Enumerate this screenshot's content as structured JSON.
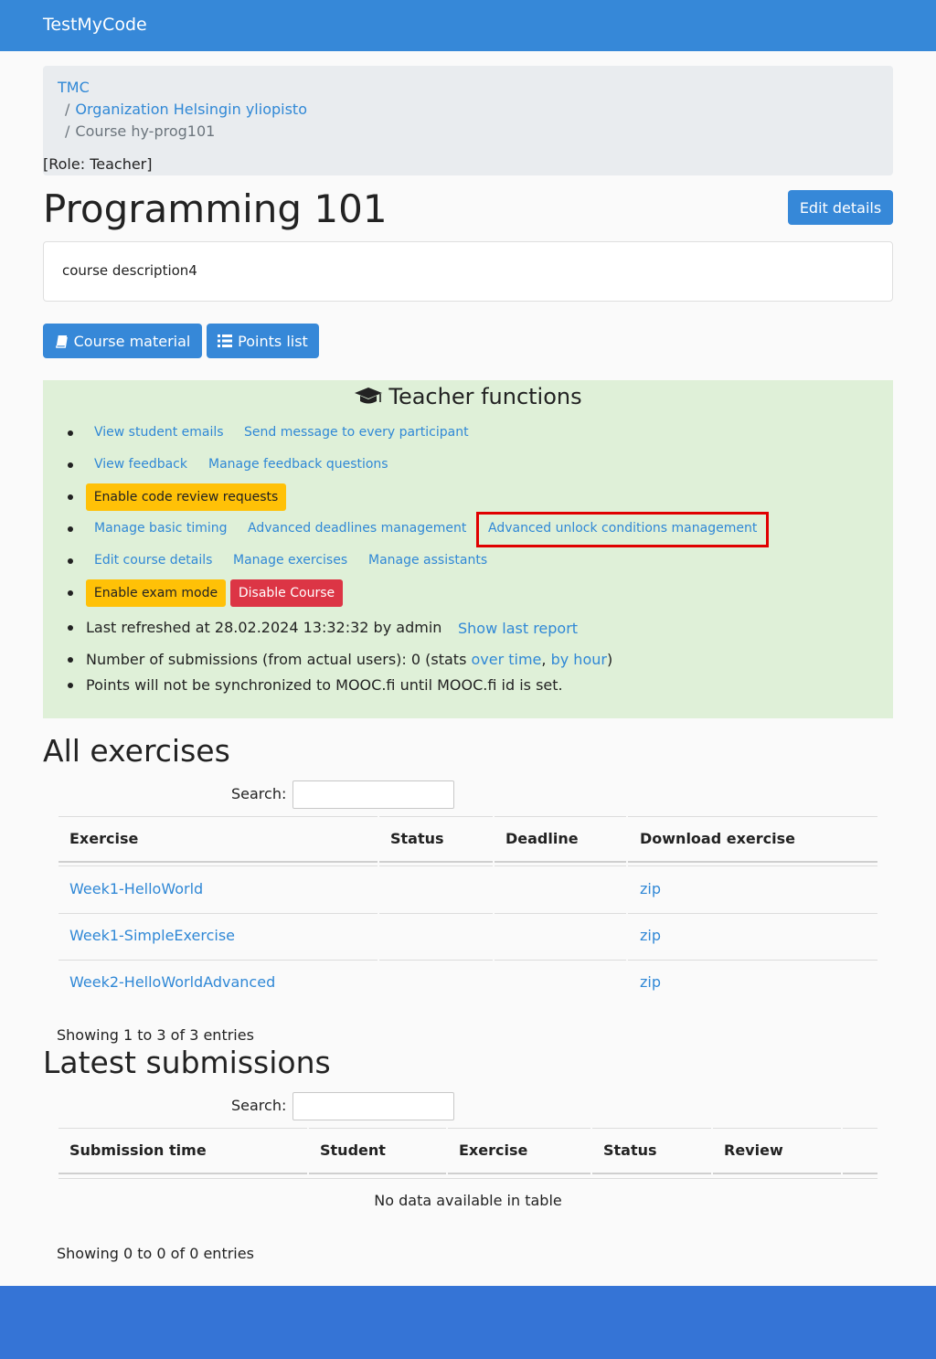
{
  "navbar": {
    "brand": "TestMyCode"
  },
  "breadcrumb": {
    "items": [
      "TMC",
      "Organization Helsingin yliopisto",
      "Course hy-prog101"
    ],
    "separator": "/",
    "role": "[Role: Teacher]"
  },
  "course": {
    "title": "Programming 101",
    "edit_label": "Edit details",
    "description": "course description4",
    "material_label": "Course material",
    "points_label": "Points list"
  },
  "teacher": {
    "title": "Teacher functions",
    "view_student_emails": "View student emails",
    "send_message": "Send message to every participant",
    "view_feedback": "View feedback",
    "manage_feedback_questions": "Manage feedback questions",
    "enable_code_review": "Enable code review requests",
    "manage_basic_timing": "Manage basic timing",
    "advanced_deadlines": "Advanced deadlines management",
    "advanced_unlock": "Advanced unlock conditions management",
    "edit_course_details": "Edit course details",
    "manage_exercises": "Manage exercises",
    "manage_assistants": "Manage assistants",
    "enable_exam_mode": "Enable exam mode",
    "disable_course": "Disable Course",
    "last_refreshed": "Last refreshed at 28.02.2024 13:32:32 by admin",
    "show_last_report": "Show last report",
    "submissions_prefix": "Number of submissions (from actual users): 0 (stats ",
    "over_time": "over time",
    "comma": ",",
    "by_hour": "by hour",
    "close_paren": ")",
    "mooc_note": "Points will not be synchronized to MOOC.fi until MOOC.fi id is set."
  },
  "exercises": {
    "title": "All exercises",
    "search_label": "Search:",
    "search_value": "",
    "columns": [
      "Exercise",
      "Status",
      "Deadline",
      "Download exercise"
    ],
    "rows": [
      {
        "name": "Week1-HelloWorld",
        "status": "",
        "deadline": "",
        "download": "zip"
      },
      {
        "name": "Week1-SimpleExercise",
        "status": "",
        "deadline": "",
        "download": "zip"
      },
      {
        "name": "Week2-HelloWorldAdvanced",
        "status": "",
        "deadline": "",
        "download": "zip"
      }
    ],
    "info": "Showing 1 to 3 of 3 entries"
  },
  "submissions": {
    "title": "Latest submissions",
    "search_label": "Search:",
    "search_value": "",
    "columns": [
      "Submission time",
      "Student",
      "Exercise",
      "Status",
      "Review"
    ],
    "empty": "No data available in table",
    "info": "Showing 0 to 0 of 0 entries"
  },
  "colors": {
    "navbar": "#3688d8",
    "footer": "#3574d6",
    "teacher_panel": "#dff0d8",
    "warning": "#ffc107",
    "danger": "#dc3545",
    "highlight": "#e00000",
    "link": "#3088d6"
  },
  "icons": {
    "course_material": "book-icon",
    "points_list": "list-icon",
    "teacher_functions": "graduation-cap-icon"
  }
}
